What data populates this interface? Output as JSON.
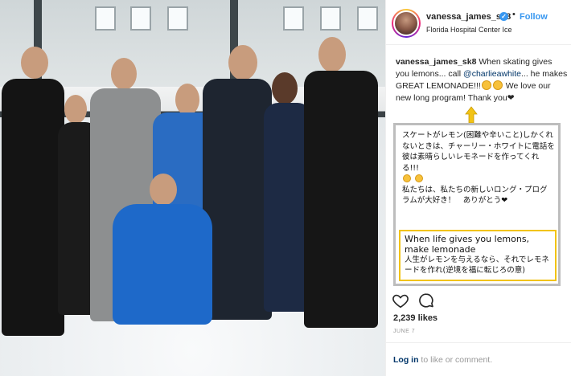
{
  "post": {
    "username": "vanessa_james_sk8",
    "verified": true,
    "follow_label": "Follow",
    "separator": "•",
    "location": "Florida Hospital Center Ice",
    "caption": {
      "username": "vanessa_james_sk8",
      "text_part1": " When skating gives you lemons... call ",
      "mention": "@charlieawhite",
      "text_part2": "... he makes GREAT LEMONADE!!!",
      "text_part3": " We love our new long program! Thank you❤"
    },
    "likes": "2,239 likes",
    "date": "JUNE 7",
    "login": {
      "link_label": "Log in",
      "rest": " to like or comment."
    }
  },
  "annotation": {
    "jp_line1": "スケートがレモン(困難や辛いこと)しかくれないときは、チャーリー・ホワイトに電話を彼は素晴らしいレモネードを作ってくれる!!!",
    "jp_line2": "私たちは、私たちの新しいロング・プログラムが大好き！　ありがとう❤",
    "idiom_en_1": "When life gives you lemons,",
    "idiom_en_2": "make lemonade",
    "idiom_jp": "人生がレモンを与えるなら、それでレモネードを作れ(逆境を福に転じろの意)"
  },
  "icons": {
    "heart": "heart-outline-icon",
    "comment": "comment-bubble-icon",
    "verified": "verified-badge-icon",
    "arrow": "arrow-up-icon"
  },
  "colors": {
    "accent": "#3897f0",
    "mention": "#003569",
    "highlight_box": "#f2c315",
    "note_border": "#bdbdbd"
  }
}
